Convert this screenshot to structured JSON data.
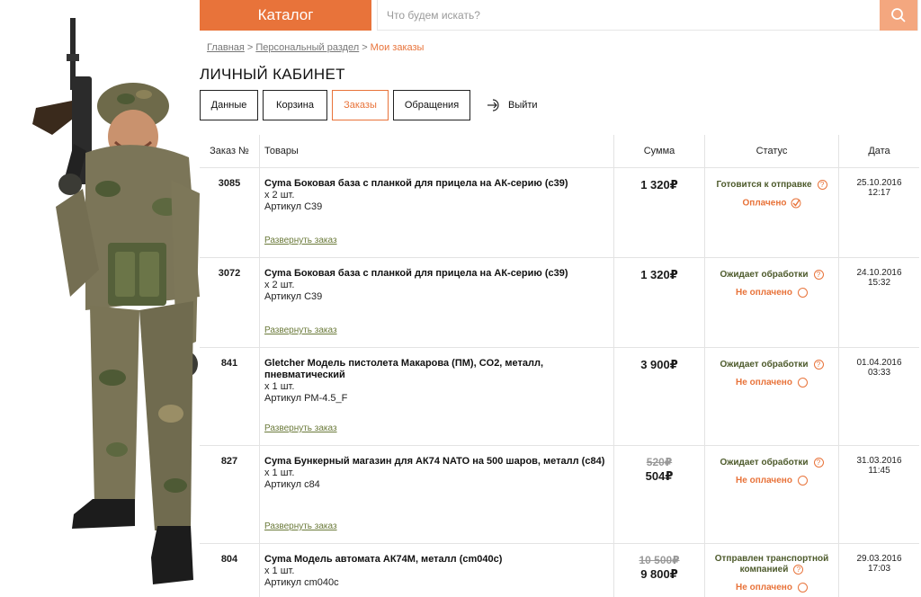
{
  "header": {
    "catalog_label": "Каталог",
    "search_placeholder": "Что будем искать?"
  },
  "breadcrumb": {
    "items": [
      "Главная",
      "Персональный раздел"
    ],
    "current": "Мои заказы",
    "separator": ">"
  },
  "page_title": "ЛИЧНЫЙ КАБИНЕТ",
  "tabs": [
    {
      "label": "Данные",
      "active": false
    },
    {
      "label": "Корзина",
      "active": false
    },
    {
      "label": "Заказы",
      "active": true
    },
    {
      "label": "Обращения",
      "active": false
    }
  ],
  "logout_label": "Выйти",
  "table": {
    "columns": [
      "Заказ №",
      "Товары",
      "Сумма",
      "Статус",
      "Дата"
    ],
    "expand_label": "Развернуть заказ",
    "orders": [
      {
        "number": "3085",
        "name": "Cyma Боковая база с планкой для прицела на АК-серию (c39)",
        "qty": "х 2 шт.",
        "sku": "Артикул C39",
        "old_price": "",
        "price": "1 320",
        "currency": "₽",
        "status": "Готовится к отправке",
        "payment": "Оплачено",
        "paid": true,
        "date": "25.10.2016",
        "time": "12:17"
      },
      {
        "number": "3072",
        "name": "Cyma Боковая база с планкой для прицела на АК-серию (c39)",
        "qty": "х 2 шт.",
        "sku": "Артикул C39",
        "old_price": "",
        "price": "1 320",
        "currency": "₽",
        "status": "Ожидает обработки",
        "payment": "Не оплачено",
        "paid": false,
        "date": "24.10.2016",
        "time": "15:32"
      },
      {
        "number": "841",
        "name": "Gletcher Модель пистолета Макарова (ПМ), CO2, металл, пневматический",
        "qty": "х 1 шт.",
        "sku": "Артикул PM-4.5_F",
        "old_price": "",
        "price": "3 900",
        "currency": "₽",
        "status": "Ожидает обработки",
        "payment": "Не оплачено",
        "paid": false,
        "date": "01.04.2016",
        "time": "03:33"
      },
      {
        "number": "827",
        "name": "Cyma Бункерный магазин для АК74 NATO на 500 шаров, металл (c84)",
        "qty": "х 1 шт.",
        "sku": "Артикул c84",
        "old_price": "520",
        "price": "504",
        "currency": "₽",
        "status": "Ожидает обработки",
        "payment": "Не оплачено",
        "paid": false,
        "date": "31.03.2016",
        "time": "11:45"
      },
      {
        "number": "804",
        "name": "Cyma Модель автомата АК74М, металл (cm040c)",
        "qty": "х 1 шт.",
        "sku": "Артикул cm040c",
        "old_price": "10 500",
        "price": "9 800",
        "currency": "₽",
        "status": "Отправлен транспортной компанией",
        "payment": "Не оплачено",
        "paid": false,
        "date": "29.03.2016",
        "time": "17:03"
      }
    ]
  },
  "colors": {
    "accent": "#e8733a",
    "accent_light": "#f4a77f",
    "status_text": "#4d5a2b",
    "link": "#6b7a3a",
    "border": "#e3e3e3"
  },
  "icons": {
    "search": "search-icon",
    "logout": "logout-icon",
    "help": "question-icon",
    "paid": "check-circle-icon",
    "unpaid": "empty-circle-icon"
  }
}
